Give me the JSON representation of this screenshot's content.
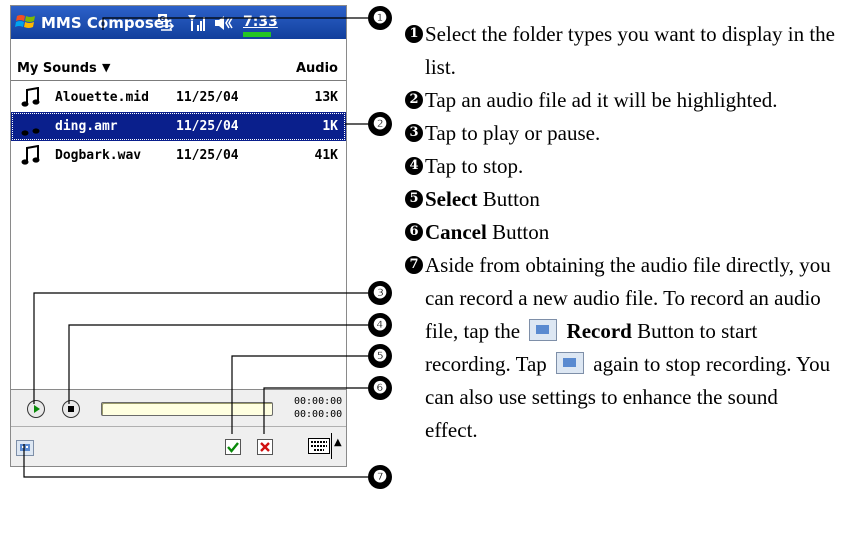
{
  "pda": {
    "app_title": "MMS Composer",
    "clock": "7:33",
    "folder_label": "My Sounds",
    "type_label": "Audio",
    "files": [
      {
        "name": "Alouette.mid",
        "date": "11/25/04",
        "size": "13K",
        "selected": false
      },
      {
        "name": "ding.amr",
        "date": "11/25/04",
        "size": "1K",
        "selected": true
      },
      {
        "name": "Dogbark.wav",
        "date": "11/25/04",
        "size": "41K",
        "selected": false
      }
    ],
    "elapsed_time": "00:00:00",
    "total_time": "00:00:00"
  },
  "callouts": [
    "❶",
    "❷",
    "❸",
    "❹",
    "❺",
    "❻",
    "❼"
  ],
  "instructions": {
    "i1": {
      "num": "1",
      "text": "Select the folder types you want to display in the list."
    },
    "i2": {
      "num": "2",
      "text": "Tap an audio file ad it will be highlighted."
    },
    "i3": {
      "num": "3",
      "text": "Tap to play or pause."
    },
    "i4": {
      "num": "4",
      "text": "Tap to stop."
    },
    "i5": {
      "num": "5",
      "bold": "Select",
      "rest": " Button"
    },
    "i6": {
      "num": "6",
      "bold": "Cancel",
      "rest": " Button"
    },
    "i7": {
      "num": "7",
      "part1": "Aside from obtaining the audio file directly, you can record a new audio file. To record an audio file, tap the",
      "bold": "Record",
      "part2": " Button to start recording. Tap",
      "part3": " again to stop recording. You can also use settings to enhance the sound effect."
    }
  }
}
